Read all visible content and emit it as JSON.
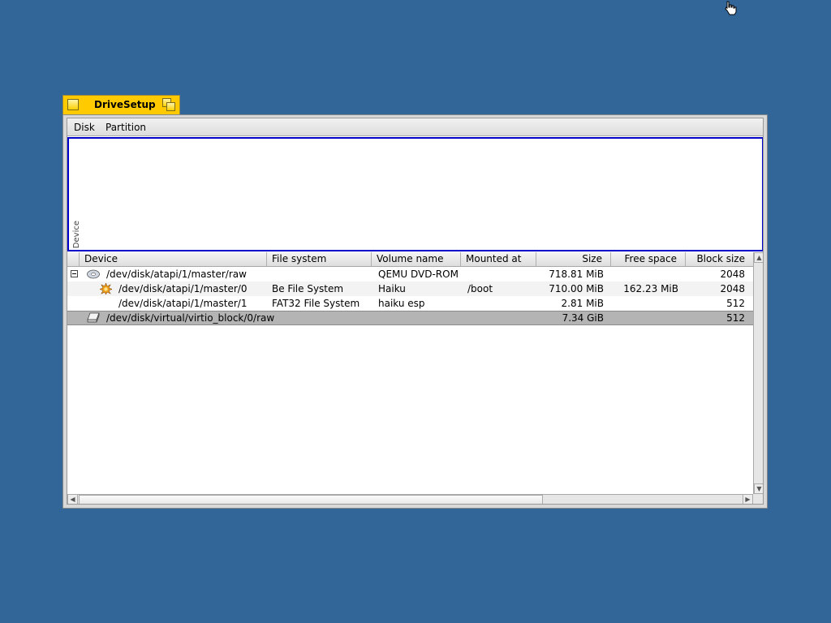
{
  "window": {
    "title": "DriveSetup"
  },
  "menubar": {
    "items": [
      "Disk",
      "Partition"
    ]
  },
  "disk_map": {
    "label": "Device"
  },
  "table": {
    "columns": [
      "Device",
      "File system",
      "Volume name",
      "Mounted at",
      "Size",
      "Free space",
      "Block size"
    ],
    "rows": [
      {
        "device": "/dev/disk/atapi/1/master/raw",
        "file_system": "",
        "volume_name": "QEMU DVD-ROM",
        "mounted_at": "",
        "size": "718.81 MiB",
        "free_space": "",
        "block_size": "2048",
        "icon": "cd-disk-icon"
      },
      {
        "device": "/dev/disk/atapi/1/master/0",
        "file_system": "Be File System",
        "volume_name": "Haiku",
        "mounted_at": "/boot",
        "size": "710.00 MiB",
        "free_space": "162.23 MiB",
        "block_size": "2048",
        "icon": "haiku-volume-icon"
      },
      {
        "device": "/dev/disk/atapi/1/master/1",
        "file_system": "FAT32 File System",
        "volume_name": "haiku esp",
        "mounted_at": "",
        "size": "2.81 MiB",
        "free_space": "",
        "block_size": "512",
        "icon": ""
      },
      {
        "device": "/dev/disk/virtual/virtio_block/0/raw",
        "file_system": "",
        "volume_name": "",
        "mounted_at": "",
        "size": "7.34 GiB",
        "free_space": "",
        "block_size": "512",
        "icon": "hard-drive-icon"
      }
    ]
  },
  "colors": {
    "desktop": "#336698",
    "title_tab": "#ffcb00",
    "selection_border": "#0000c8",
    "selected_row": "#b4b4b4"
  }
}
